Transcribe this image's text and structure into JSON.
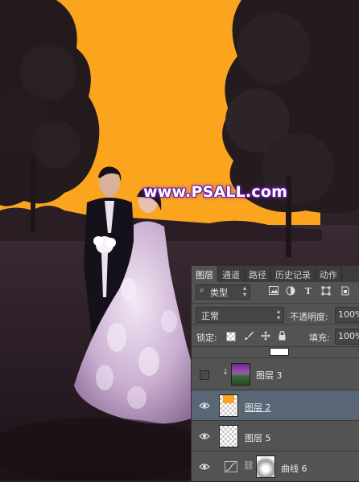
{
  "watermark": "www.PSALL.com",
  "colors": {
    "sky": "#fba41e",
    "panel": "#535353",
    "selected_row": "#596676",
    "watermark_outline": "#6a1aa8"
  },
  "panel": {
    "tabs": [
      "图层",
      "通道",
      "路径",
      "历史记录",
      "动作"
    ],
    "active_tab": 0,
    "filter": {
      "label": "类型",
      "icons": [
        "image-icon",
        "adjustment-circle-icon",
        "type-icon",
        "shape-transform-icon",
        "smart-object-icon"
      ],
      "type_glyph": "T"
    },
    "blend_mode": "正常",
    "opacity_label": "不透明度:",
    "opacity_value": "100%",
    "lock_label": "锁定:",
    "fill_label": "填充:",
    "fill_value": "100%",
    "layers": [
      {
        "name": "图层 3",
        "visible": false,
        "clipped": true,
        "thumb": "landscape"
      },
      {
        "name": "图层 2",
        "visible": true,
        "selected": true,
        "thumb": "orange-on-checker"
      },
      {
        "name": "图层 5",
        "visible": true,
        "thumb": "checker"
      },
      {
        "name": "曲线 6",
        "visible": true,
        "adjustment": true,
        "thumb": "mask"
      }
    ]
  }
}
